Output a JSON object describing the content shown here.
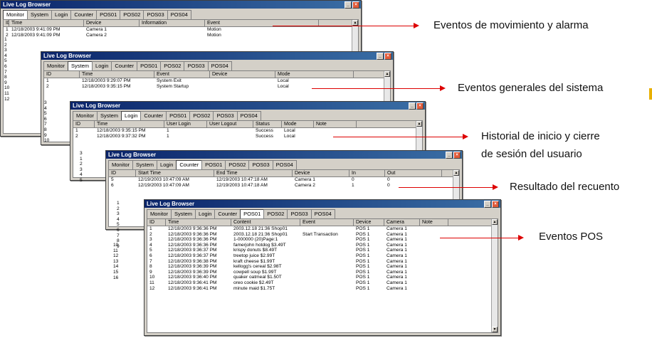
{
  "app_title": "Live Log Browser",
  "tab_labels": [
    "Monitor",
    "System",
    "Login",
    "Counter",
    "POS01",
    "POS02",
    "POS03",
    "POS04"
  ],
  "windows": {
    "monitor": {
      "headers": [
        "ID",
        "Time",
        "Device",
        "Information",
        "Event"
      ],
      "rows": [
        [
          "1",
          "12/18/2003 9:41:09 PM",
          "Camera 1",
          "",
          "Motion"
        ],
        [
          "2",
          "12/18/2003 9:41:09 PM",
          "Camera 2",
          "",
          "Motion"
        ]
      ],
      "ids": [
        "1",
        "2",
        "3",
        "4",
        "5",
        "6",
        "7",
        "8",
        "9",
        "10",
        "11",
        "12"
      ]
    },
    "system": {
      "headers": [
        "ID",
        "Time",
        "Event",
        "Device",
        "Mode"
      ],
      "rows": [
        [
          "1",
          "12/18/2003 9:29:07 PM",
          "System Exit",
          "",
          "Local"
        ],
        [
          "2",
          "12/18/2003 9:35:15 PM",
          "System Startup",
          "",
          "Local"
        ]
      ],
      "ids": [
        "3",
        "4",
        "5",
        "6",
        "7",
        "8",
        "9",
        "10"
      ]
    },
    "login": {
      "headers": [
        "ID",
        "Time",
        "User Login",
        "User Logout",
        "Status",
        "Mode",
        "Note"
      ],
      "rows": [
        [
          "1",
          "12/18/2003 9:35:15 PM",
          "1",
          "",
          "Success",
          "Local",
          ""
        ],
        [
          "2",
          "12/18/2003 9:37:32 PM",
          "1",
          "",
          "Success",
          "Local",
          ""
        ]
      ],
      "ids": [
        "3",
        "1",
        "2",
        "3",
        "4",
        "5"
      ]
    },
    "counter": {
      "headers": [
        "ID",
        "Start Time",
        "End Time",
        "Device",
        "In",
        "Out"
      ],
      "rows": [
        [
          "5",
          "12/19/2003 10:47:09 AM",
          "12/19/2003 10:47:18 AM",
          "Camera 1",
          "0",
          "0"
        ],
        [
          "6",
          "12/19/2003 10:47:09 AM",
          "12/19/2003 10:47:18 AM",
          "Camera 2",
          "1",
          "0"
        ]
      ],
      "ids": [
        "1",
        "2",
        "3",
        "4",
        "5",
        "6",
        "7",
        "8",
        "9"
      ]
    },
    "pos": {
      "headers": [
        "ID",
        "Time",
        "Content",
        "Event",
        "Device",
        "Camera",
        "Note"
      ],
      "rows": [
        [
          "1",
          "12/18/2003 9:36:36 PM",
          "2003.12.18 21:36 Shop01",
          "",
          "POS 1",
          "Camera 1",
          ""
        ],
        [
          "2",
          "12/18/2003 9:36:36 PM",
          "2003.12.18 21:36 Shop01",
          "Start Transaction",
          "POS 1",
          "Camera 1",
          ""
        ],
        [
          "3",
          "12/18/2003 9:36:36 PM",
          "1-000000    (20)Page:1",
          "",
          "POS 1",
          "Camera 1",
          ""
        ],
        [
          "4",
          "12/18/2003 9:36:36 PM",
          "famerjohn hotdog $3.49T",
          "",
          "POS 1",
          "Camera 1",
          ""
        ],
        [
          "5",
          "12/18/2003 9:36:37 PM",
          "krispy donuts   $8.49T",
          "",
          "POS 1",
          "Camera 1",
          ""
        ],
        [
          "6",
          "12/18/2003 9:36:37 PM",
          "treetop juice   $2.99T",
          "",
          "POS 1",
          "Camera 1",
          ""
        ],
        [
          "7",
          "12/18/2003 9:36:38 PM",
          "kraft cheese    $1.99T",
          "",
          "POS 1",
          "Camera 1",
          ""
        ],
        [
          "8",
          "12/18/2003 9:36:39 PM",
          "kellogg's cereal $2.98T",
          "",
          "POS 1",
          "Camera 1",
          ""
        ],
        [
          "9",
          "12/18/2003 9:36:39 PM",
          "cowpell soup    $1.99T",
          "",
          "POS 1",
          "Camera 1",
          ""
        ],
        [
          "10",
          "12/18/2003 9:36:40 PM",
          "quaker oatmeal  $1.50T",
          "",
          "POS 1",
          "Camera 1",
          ""
        ],
        [
          "11",
          "12/18/2003 9:36:41 PM",
          "oreo cookie     $2.49T",
          "",
          "POS 1",
          "Camera 1",
          ""
        ],
        [
          "12",
          "12/18/2003 9:36:41 PM",
          "minute maid     $1.75T",
          "",
          "POS 1",
          "Camera 1",
          ""
        ]
      ],
      "ids": [
        "10",
        "11",
        "12",
        "13",
        "14",
        "15",
        "16"
      ]
    }
  },
  "annotations": {
    "monitor": "Eventos de movimiento y alarma",
    "system": "Eventos generales del sistema",
    "login_line1": "Historial de inicio y cierre",
    "login_line2": "de sesión del usuario",
    "counter": "Resultado del recuento",
    "pos": "Eventos POS"
  },
  "colors": {
    "arrow": "#dd0000",
    "titlebar": "#0a246a",
    "window_bg": "#d4d0c8"
  }
}
